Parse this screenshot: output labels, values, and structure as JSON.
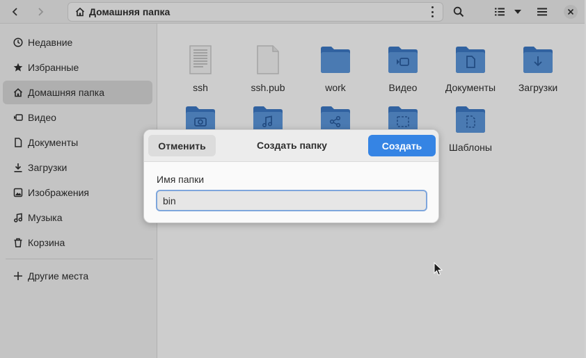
{
  "header": {
    "location_label": "Домашняя папка",
    "buttons": [
      "back",
      "forward",
      "home",
      "location-menu",
      "search",
      "view-list",
      "view-options",
      "main-menu"
    ]
  },
  "sidebar": {
    "items": [
      {
        "label": "Недавние",
        "icon": "clock-icon"
      },
      {
        "label": "Избранные",
        "icon": "star-icon"
      },
      {
        "label": "Домашняя папка",
        "icon": "home-icon",
        "active": true
      },
      {
        "label": "Видео",
        "icon": "video-icon"
      },
      {
        "label": "Документы",
        "icon": "document-icon"
      },
      {
        "label": "Загрузки",
        "icon": "download-icon"
      },
      {
        "label": "Изображения",
        "icon": "image-icon"
      },
      {
        "label": "Музыка",
        "icon": "music-icon"
      },
      {
        "label": "Корзина",
        "icon": "trash-icon"
      }
    ],
    "other_places": "Другие места"
  },
  "files": [
    {
      "name": "ssh",
      "type": "text-file"
    },
    {
      "name": "ssh.pub",
      "type": "blank-file"
    },
    {
      "name": "work",
      "type": "folder"
    },
    {
      "name": "Видео",
      "type": "folder-video"
    },
    {
      "name": "Документы",
      "type": "folder-documents"
    },
    {
      "name": "Загрузки",
      "type": "folder-download"
    },
    {
      "name": "",
      "type": "folder-pictures"
    },
    {
      "name": "",
      "type": "folder-music"
    },
    {
      "name": "",
      "type": "folder-public"
    },
    {
      "name": "",
      "type": "folder-desktop"
    },
    {
      "name": "Шаблоны",
      "type": "folder-templates"
    }
  ],
  "dialog": {
    "cancel_label": "Отменить",
    "title": "Создать папку",
    "create_label": "Создать",
    "field_label": "Имя папки",
    "field_value": "bin"
  },
  "colors": {
    "accent": "#3584e4",
    "folder": "#4a86cf",
    "folder_light": "#a3c2ea"
  }
}
